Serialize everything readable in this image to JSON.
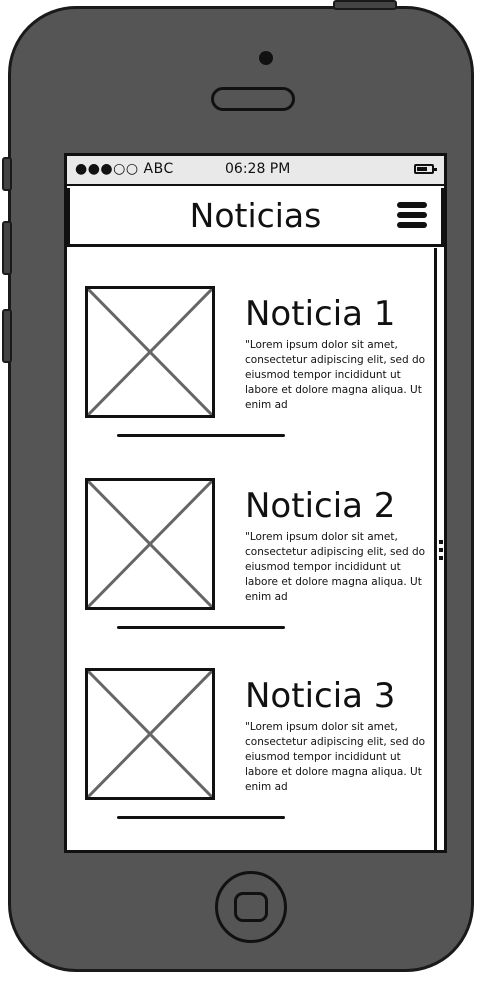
{
  "status_bar": {
    "carrier": "●●●○○ ABC",
    "time": "06:28 PM"
  },
  "header": {
    "title": "Noticias"
  },
  "news": [
    {
      "title": "Noticia 1",
      "excerpt": "\"Lorem ipsum dolor sit amet, consectetur adipiscing elit, sed do eiusmod tempor incididunt ut labore et dolore magna aliqua. Ut enim ad"
    },
    {
      "title": "Noticia 2",
      "excerpt": "\"Lorem ipsum dolor sit amet, consectetur adipiscing elit, sed do eiusmod tempor incididunt ut labore et dolore magna aliqua. Ut enim ad"
    },
    {
      "title": "Noticia 3",
      "excerpt": "\"Lorem ipsum dolor sit amet, consectetur adipiscing elit, sed do eiusmod tempor incididunt ut labore et dolore magna aliqua. Ut enim ad"
    }
  ],
  "icons": {
    "menu": "hamburger-menu-icon",
    "battery": "battery-icon",
    "image_placeholder": "image-placeholder-icon",
    "home_button": "home-button-icon"
  }
}
